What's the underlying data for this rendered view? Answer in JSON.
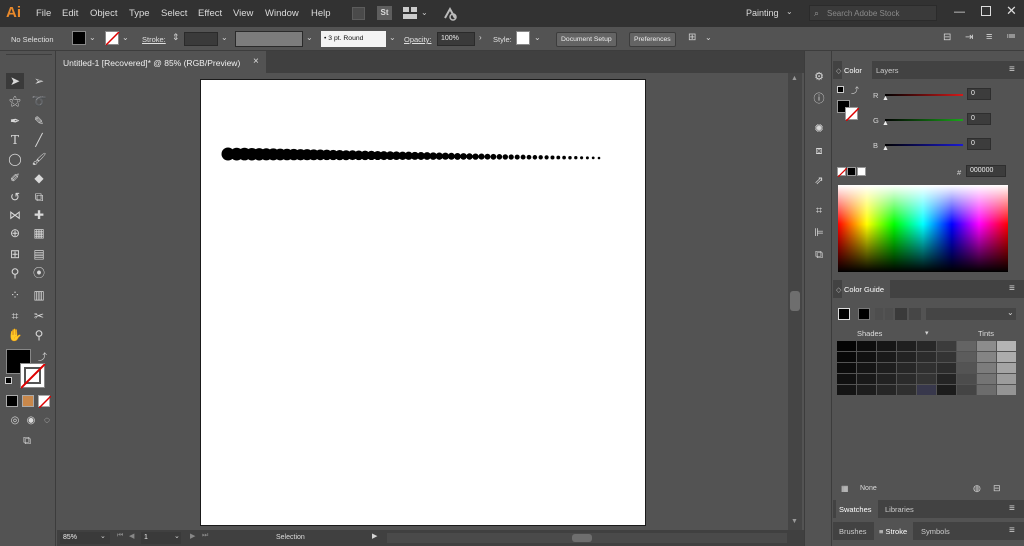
{
  "app": {
    "logo": "Ai",
    "workspace": "Painting",
    "search_placeholder": "Search Adobe Stock",
    "st_badge": "St"
  },
  "menu": [
    "File",
    "Edit",
    "Object",
    "Type",
    "Select",
    "Effect",
    "View",
    "Window",
    "Help"
  ],
  "control": {
    "selection_label": "No Selection",
    "stroke_label": "Stroke:",
    "brush_label": "3 pt. Round",
    "opacity_label": "Opacity:",
    "opacity_value": "100%",
    "style_label": "Style:",
    "document_setup": "Document Setup",
    "preferences": "Preferences"
  },
  "document": {
    "tab_title": "Untitled-1 [Recovered]* @ 85% (RGB/Preview)",
    "close": "×"
  },
  "status": {
    "zoom": "85%",
    "page": "1",
    "tool": "Selection"
  },
  "color_panel": {
    "tabs": [
      "Color",
      "Layers"
    ],
    "r_label": "R",
    "g_label": "G",
    "b_label": "B",
    "r_value": "0",
    "g_value": "0",
    "b_value": "0",
    "hex_symbol": "#",
    "hex_value": "000000"
  },
  "color_guide": {
    "title": "Color Guide",
    "shades": "Shades",
    "tints": "Tints"
  },
  "swatches": {
    "tabs": [
      "Swatches",
      "Libraries"
    ],
    "none_label": "None"
  },
  "bottom_tabs": [
    "Brushes",
    "Stroke",
    "Symbols"
  ],
  "colors": {
    "accent_orange": "#e8892b",
    "panel_bg": "#535353",
    "menubar_bg": "#323232",
    "red_track": "#d31a1a",
    "green_track": "#1aa61a",
    "blue_track": "#1a1ad3"
  }
}
